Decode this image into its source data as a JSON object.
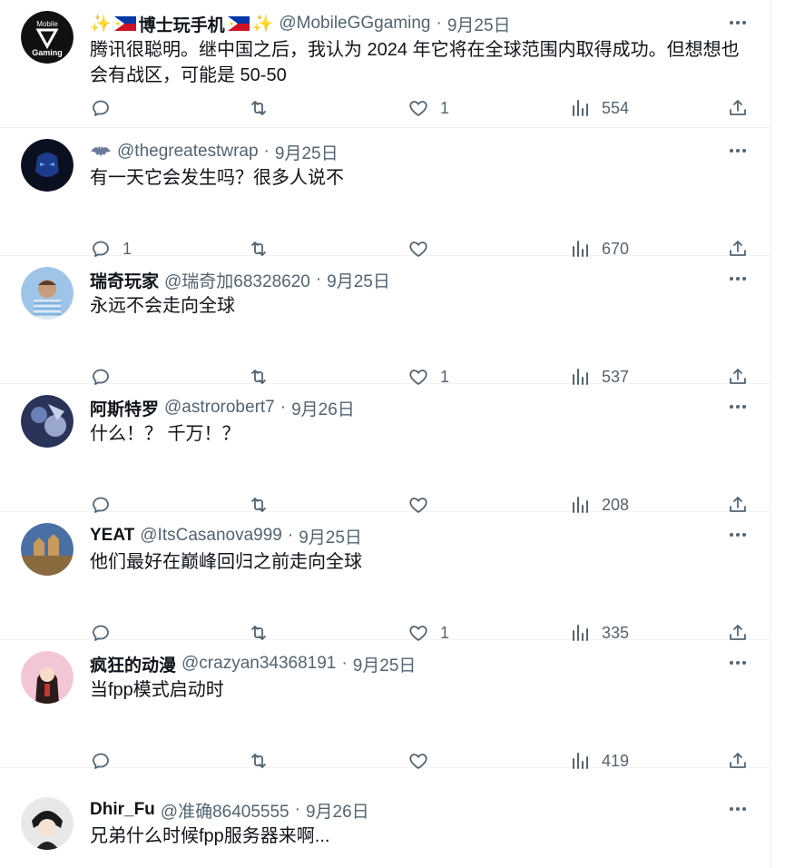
{
  "tweets": [
    {
      "name": "博士玩手机",
      "prefix": "✨",
      "suffix": "✨",
      "handle": "@MobileGGgaming",
      "date": "9月25日",
      "text": "腾讯很聪明。继中国之后，我认为 2024 年它将在全球范围内取得成功。但想想也会有战区，可能是 50-50",
      "replies": "",
      "likes": "1",
      "views": "554",
      "avatar_text_top": "Mobile",
      "avatar_text_bottom": "Gaming"
    },
    {
      "name": "",
      "handle": "@thegreatestwrap",
      "date": "9月25日",
      "text": "有一天它会发生吗？很多人说不",
      "replies": "1",
      "likes": "",
      "views": "670"
    },
    {
      "name": "瑞奇玩家",
      "handle": "@瑞奇加68328620",
      "date": "9月25日",
      "text": "永远不会走向全球",
      "replies": "",
      "likes": "1",
      "views": "537"
    },
    {
      "name": "阿斯特罗",
      "handle": "@astrorobert7",
      "date": "9月26日",
      "text": "什么！？ 千万！？",
      "replies": "",
      "likes": "",
      "views": "208"
    },
    {
      "name": "YEAT",
      "handle": "@ItsCasanova999",
      "date": "9月25日",
      "text": "他们最好在巅峰回归之前走向全球",
      "replies": "",
      "likes": "1",
      "views": "335"
    },
    {
      "name": "疯狂的动漫",
      "handle": "@crazyan34368191",
      "date": "9月25日",
      "text": "当fpp模式启动时",
      "replies": "",
      "likes": "",
      "views": "419"
    },
    {
      "name": "Dhir_Fu",
      "handle": "@准确86405555",
      "date": "9月26日",
      "text": "兄弟什么时候fpp服务器来啊...",
      "replies": "",
      "likes": "",
      "views": ""
    }
  ],
  "separator": "·",
  "colors": {
    "text": "#0f1419",
    "secondary": "#536471",
    "border": "#eff3f4"
  }
}
